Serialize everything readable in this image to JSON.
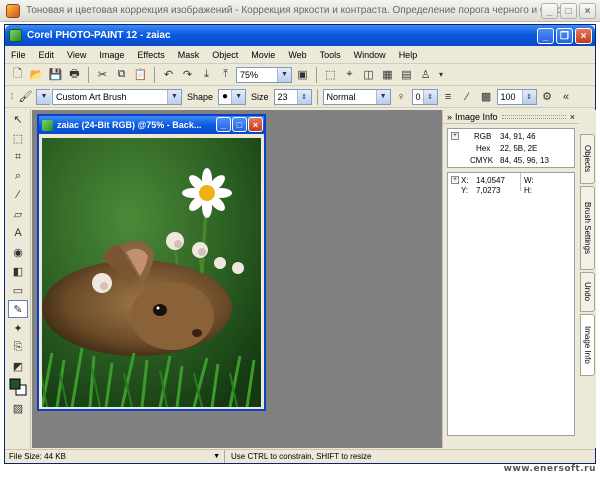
{
  "outer_window": {
    "title": "Тоновая и цветовая коррекция изображений - Коррекция яркости и контраста. Определение порога черного и белого"
  },
  "app": {
    "title": "Corel PHOTO-PAINT 12 - zaiac"
  },
  "menu": [
    {
      "label": "File"
    },
    {
      "label": "Edit"
    },
    {
      "label": "View"
    },
    {
      "label": "Image"
    },
    {
      "label": "Effects"
    },
    {
      "label": "Mask"
    },
    {
      "label": "Object"
    },
    {
      "label": "Movie"
    },
    {
      "label": "Web"
    },
    {
      "label": "Tools"
    },
    {
      "label": "Window"
    },
    {
      "label": "Help"
    }
  ],
  "standard_toolbar": {
    "zoom_value": "75%"
  },
  "property_bar": {
    "brush_type": "Custom Art Brush",
    "shape_label": "Shape",
    "size_label": "Size",
    "size_value": "23",
    "merge_mode": "Normal",
    "transparency_value": "0",
    "opacity_value": "100"
  },
  "document": {
    "title": "zaiac (24-Bit RGB) @75% - Back..."
  },
  "docker": {
    "title": "Image Info",
    "color": {
      "rgb_label": "RGB",
      "rgb_value": "34, 91, 46",
      "hex_label": "Hex",
      "hex_value": "22, 5B, 2E",
      "cmyk_label": "CMYK",
      "cmyk_value": "84, 45, 96, 13"
    },
    "position": {
      "x_label": "X:",
      "x_value": "14,0547",
      "y_label": "Y:",
      "y_value": "7,0273",
      "w_label": "W:",
      "h_label": "H:"
    }
  },
  "side_tabs": [
    {
      "label": "Objects"
    },
    {
      "label": "Brush Settings"
    },
    {
      "label": "Undo"
    },
    {
      "label": "Image Info"
    }
  ],
  "status": {
    "file_size": "File Size: 44 KB",
    "hint": "Use CTRL to constrain, SHIFT to resize"
  },
  "watermark": "www.enersoft.ru"
}
